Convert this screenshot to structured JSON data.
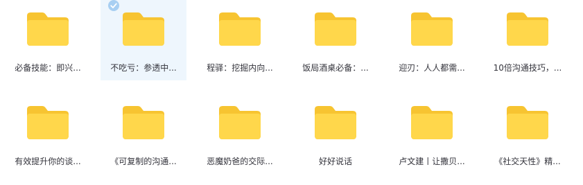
{
  "folders": [
    {
      "name": "必备技能：即兴..."
    },
    {
      "name": "不吃亏：参透中...",
      "selected": true
    },
    {
      "name": "程驿：挖掘内向..."
    },
    {
      "name": "饭局酒桌必备：..."
    },
    {
      "name": "迎刃：人人都需..."
    },
    {
      "name": "10倍沟通技巧，..."
    },
    {
      "name": "有效提升你的谈..."
    },
    {
      "name": "《可复制的沟通..."
    },
    {
      "name": "恶魔奶爸的交际..."
    },
    {
      "name": "好好说话"
    },
    {
      "name": "卢文建丨让撒贝..."
    },
    {
      "name": "《社交天性》精..."
    }
  ],
  "icons": {
    "folder": "folder-icon",
    "selected": "check-circle-icon"
  },
  "colors": {
    "folder_back": "#f7c431",
    "folder_front": "#ffd74b",
    "selected_bg": "#eef6fd",
    "check": "#a8cff2",
    "text": "#33333b"
  }
}
